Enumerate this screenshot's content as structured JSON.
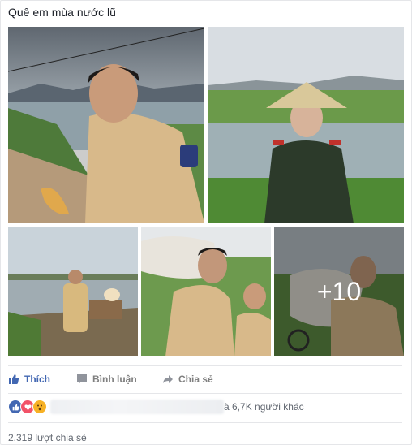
{
  "post": {
    "caption": "Quê em mùa nước lũ"
  },
  "photos": {
    "more_overlay": "+10"
  },
  "actions": {
    "like": "Thích",
    "comment": "Bình luận",
    "share": "Chia sẻ"
  },
  "reactions": {
    "types": [
      "like-icon",
      "love-icon",
      "wow-icon"
    ],
    "others_text": "à 6,7K người khác"
  },
  "shares_text": "2.319 lượt chia sẻ",
  "colors": {
    "accent": "#4267b2",
    "love": "#f25268",
    "wow": "#f7b125"
  }
}
